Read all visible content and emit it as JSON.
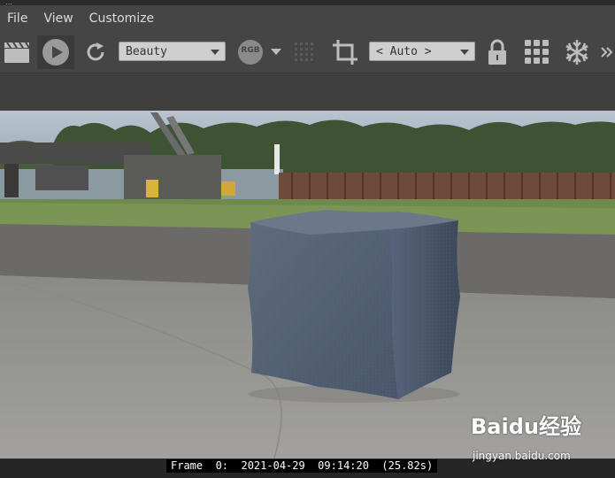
{
  "menu": {
    "items": [
      {
        "label": "File"
      },
      {
        "label": "View"
      },
      {
        "label": "Customize"
      }
    ]
  },
  "toolbar": {
    "channel_value": "Beauty",
    "rgb_label": "RGB",
    "lut_value": "< Auto >",
    "icons": [
      "clapperboard-icon",
      "play-icon",
      "refresh-icon",
      "rgb-icon",
      "dropdown-arrow-icon",
      "dotted-grid-icon",
      "crop-icon",
      "lock-icon",
      "grid-icon",
      "snowflake-icon",
      "more-icon"
    ]
  },
  "status": {
    "text": "Frame  0:  2021-04-29  09:14:20  (25.82s)"
  },
  "watermark": {
    "brand": "Baidu经验",
    "url": "jingyan.baidu.com"
  },
  "colors": {
    "background": "#3c3c3c",
    "toolbar": "#454545",
    "dropdown": "#cfcfcf",
    "icon": "#bdbdbd",
    "cube": "#5a6878"
  }
}
